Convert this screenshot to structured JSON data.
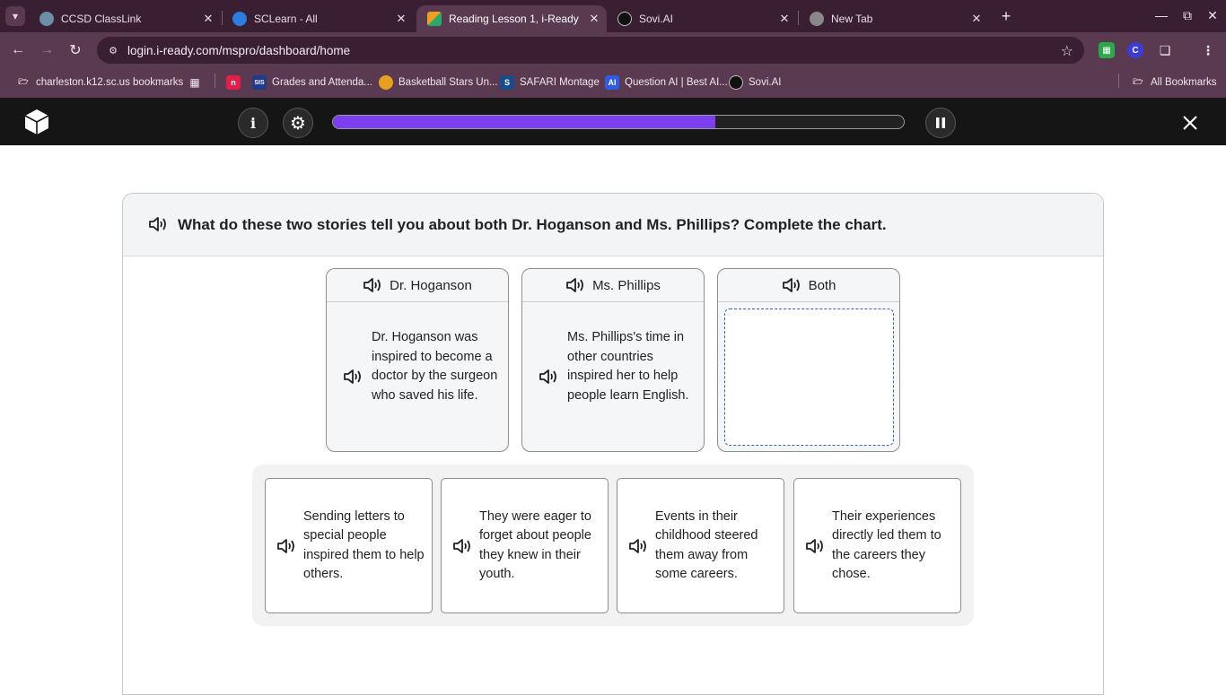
{
  "browser": {
    "tabs": [
      {
        "title": "CCSD ClassLink",
        "favicon": "gear-favicon",
        "color": "#6b8fa8"
      },
      {
        "title": "SCLearn - All",
        "favicon": "sclearn-favicon",
        "color": "#2b7de0"
      },
      {
        "title": "Reading Lesson 1, i-Ready",
        "favicon": "iready-favicon",
        "color": "#f0a020"
      },
      {
        "title": "Sovi.AI",
        "favicon": "sovi-favicon",
        "color": "#222222"
      },
      {
        "title": "New Tab",
        "favicon": "chrome-favicon",
        "color": "#888888"
      }
    ],
    "url": "login.i-ready.com/mspro/dashboard/home",
    "bookmarks": [
      {
        "label": "charleston.k12.sc.us bookmarks"
      },
      {
        "label": ""
      },
      {
        "label": "Grades and Attenda..."
      },
      {
        "label": "Basketball Stars Un..."
      },
      {
        "label": "SAFARI Montage"
      },
      {
        "label": "Question AI | Best AI..."
      },
      {
        "label": "Sovi.AI"
      },
      {
        "label": "All Bookmarks"
      }
    ]
  },
  "lesson": {
    "progress_percent": 67,
    "prompt": "What do these two stories tell you about both Dr. Hoganson and Ms. Phillips? Complete the chart.",
    "columns": [
      {
        "header": "Dr. Hoganson",
        "text": "Dr. Hoganson was inspired to become a doctor by the surgeon who saved his life."
      },
      {
        "header": "Ms. Phillips",
        "text": "Ms. Phillips's time in other countries inspired her to help people learn English."
      },
      {
        "header": "Both",
        "text": ""
      }
    ],
    "choices": [
      "Sending letters to special people inspired them to help others.",
      "They were eager to forget about people they knew in their youth.",
      "Events in their childhood steered them away from some careers.",
      "Their experiences directly led them to the careers they chose."
    ]
  }
}
